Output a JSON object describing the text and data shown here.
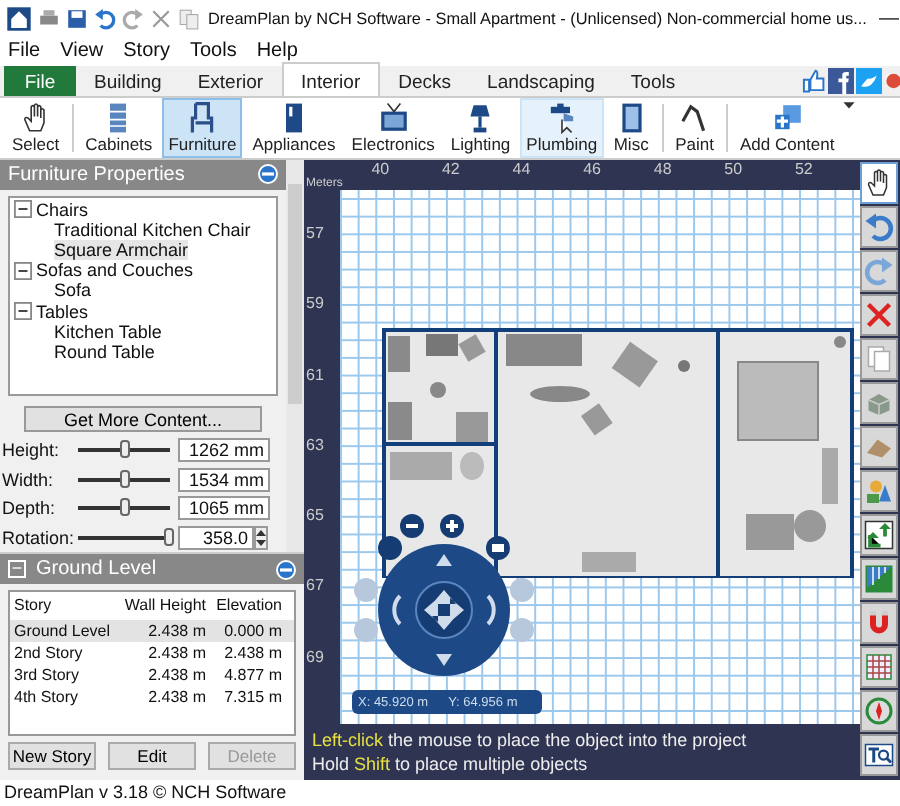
{
  "window": {
    "title": "DreamPlan by NCH Software - Small Apartment - (Unlicensed) Non-commercial home us...",
    "minimize": "—"
  },
  "menu": [
    "File",
    "View",
    "Story",
    "Tools",
    "Help"
  ],
  "tabs": [
    {
      "label": "File",
      "kind": "app",
      "selected": false
    },
    {
      "label": "Building",
      "kind": "tab",
      "selected": false
    },
    {
      "label": "Exterior",
      "kind": "tab",
      "selected": false
    },
    {
      "label": "Interior",
      "kind": "tab",
      "selected": true
    },
    {
      "label": "Decks",
      "kind": "tab",
      "selected": false
    },
    {
      "label": "Landscaping",
      "kind": "tab",
      "selected": false
    },
    {
      "label": "Tools",
      "kind": "tab",
      "selected": false
    }
  ],
  "toolbar": [
    {
      "label": "Select",
      "selected": false,
      "hovered": false
    },
    {
      "label": "Cabinets",
      "selected": false,
      "hovered": false
    },
    {
      "label": "Furniture",
      "selected": true,
      "hovered": false
    },
    {
      "label": "Appliances",
      "selected": false,
      "hovered": false
    },
    {
      "label": "Electronics",
      "selected": false,
      "hovered": false
    },
    {
      "label": "Lighting",
      "selected": false,
      "hovered": false
    },
    {
      "label": "Plumbing",
      "selected": false,
      "hovered": true
    },
    {
      "label": "Misc",
      "selected": false,
      "hovered": false
    },
    {
      "label": "Paint",
      "selected": false,
      "hovered": false
    },
    {
      "label": "Add Content",
      "selected": false,
      "hovered": false
    }
  ],
  "furniture_panel": {
    "title": "Furniture Properties",
    "tree": [
      {
        "label": "Chairs",
        "expanded": true,
        "selected": false,
        "children": [
          {
            "label": "Traditional Kitchen Chair",
            "selected": false
          },
          {
            "label": "Square Armchair",
            "selected": true
          }
        ]
      },
      {
        "label": "Sofas and Couches",
        "expanded": true,
        "selected": false,
        "children": [
          {
            "label": "Sofa",
            "selected": false
          }
        ]
      },
      {
        "label": "Tables",
        "expanded": true,
        "selected": false,
        "children": [
          {
            "label": "Kitchen Table",
            "selected": false
          },
          {
            "label": "Round Table",
            "selected": false
          }
        ]
      }
    ],
    "get_more_button": "Get More Content...",
    "properties": [
      {
        "label": "Height:",
        "kind": "slider",
        "level": 0.5,
        "value": "1262 mm"
      },
      {
        "label": "Width:",
        "kind": "slider",
        "level": 0.5,
        "value": "1534 mm"
      },
      {
        "label": "Depth:",
        "kind": "slider",
        "level": 0.5,
        "value": "1065 mm"
      },
      {
        "label": "Rotation:",
        "kind": "spinner",
        "level": 0.97,
        "value": "358.0"
      }
    ]
  },
  "level_panel": {
    "title": "Ground Level",
    "expand_sign": "−",
    "columns": [
      "Story",
      "Wall Height",
      "Elevation"
    ],
    "rows": [
      {
        "cells": [
          "Ground Level",
          "2.438 m",
          "0.000 m"
        ],
        "selected": true
      },
      {
        "cells": [
          "2nd Story",
          "2.438 m",
          "2.438 m"
        ],
        "selected": false
      },
      {
        "cells": [
          "3rd Story",
          "2.438 m",
          "4.877 m"
        ],
        "selected": false
      },
      {
        "cells": [
          "4th Story",
          "2.438 m",
          "7.315 m"
        ],
        "selected": false
      }
    ],
    "buttons": [
      {
        "label": "New Story",
        "disabled": false
      },
      {
        "label": "Edit",
        "disabled": false
      },
      {
        "label": "Delete",
        "disabled": true
      }
    ]
  },
  "canvas": {
    "unit": "Meters",
    "x_ticks": [
      "40",
      "42",
      "44",
      "46",
      "48",
      "50",
      "52"
    ],
    "y_ticks": [
      "57",
      "59",
      "61",
      "63",
      "65",
      "67",
      "69"
    ],
    "coords": {
      "x": "X: 45.920 m",
      "y": "Y: 64.956 m"
    },
    "hints": [
      [
        {
          "text": "Left-click",
          "highlight": true
        },
        {
          "text": " the mouse to place the object into the project",
          "highlight": false
        }
      ],
      [
        {
          "text": "Hold ",
          "highlight": false
        },
        {
          "text": "Shift",
          "highlight": true
        },
        {
          "text": " to place multiple objects",
          "highlight": false
        }
      ]
    ]
  },
  "side_tools": [
    {
      "selected": true
    },
    {
      "selected": false
    },
    {
      "selected": false
    },
    {
      "selected": false
    },
    {
      "selected": false
    },
    {
      "selected": false
    },
    {
      "selected": false
    },
    {
      "selected": false
    },
    {
      "selected": false
    },
    {
      "selected": false
    },
    {
      "selected": false
    },
    {
      "selected": false
    },
    {
      "selected": false
    },
    {
      "selected": false
    }
  ],
  "status_bar": "DreamPlan v 3.18 © NCH Software"
}
